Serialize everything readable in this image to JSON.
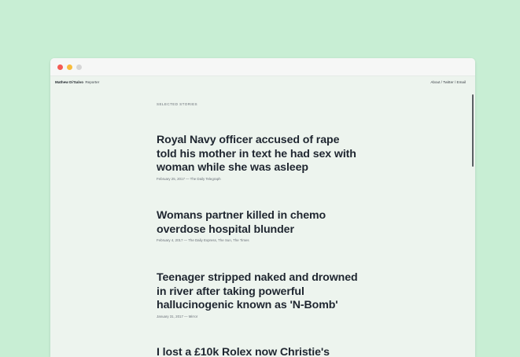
{
  "site": {
    "author_name": "Mathew Di'Salvo",
    "author_role": "Reporter",
    "nav": [
      {
        "label": "About"
      },
      {
        "label": "Twitter"
      },
      {
        "label": "Email"
      }
    ],
    "nav_separator": " / "
  },
  "section": {
    "label": "SELECTED STORIES"
  },
  "stories": [
    {
      "title": "Royal Navy officer accused of rape told his mother in text he had sex with woman while she was asleep",
      "meta": "February 25, 2017 — The Daily Telegraph"
    },
    {
      "title": "Womans partner killed in chemo overdose hospital blunder",
      "meta": "February 4, 2017 — The Daily Express, The Sun, The Times"
    },
    {
      "title": "Teenager stripped naked and drowned in river after taking powerful hallucinogenic known as 'N-Bomb'",
      "meta": "January 31, 2017 — Mirror"
    },
    {
      "title": "I lost a £10k Rolex now Christie's",
      "meta": ""
    }
  ],
  "colors": {
    "page_background": "#c8eed4",
    "window_background": "#edf4ee",
    "title_text": "#1f2630",
    "meta_text": "#6a7078",
    "close_dot": "#f45b53",
    "minimize_dot": "#f8bc3c",
    "zoom_dot": "#d6d6d6"
  }
}
